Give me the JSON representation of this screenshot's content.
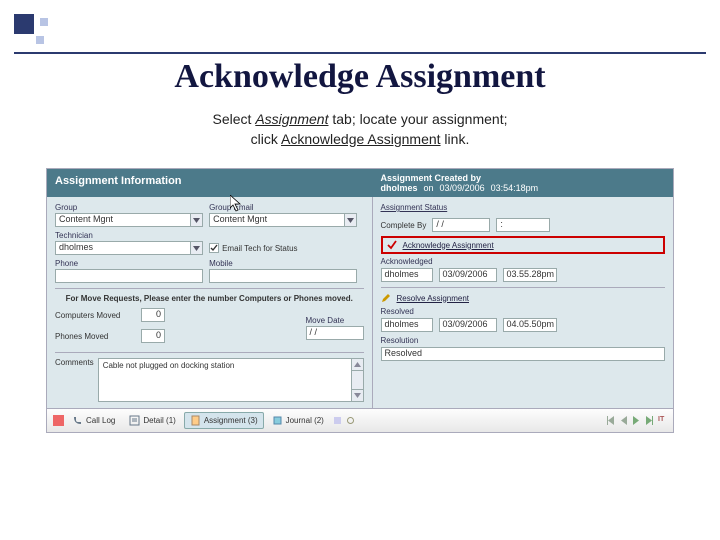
{
  "slide": {
    "title": "Acknowledge Assignment",
    "subtitle_prefix": "Select ",
    "subtitle_em": "Assignment",
    "subtitle_mid": " tab; locate your assignment;",
    "subtitle_line2_pre": "click ",
    "subtitle_link": "Acknowledge Assignment",
    "subtitle_line2_post": " link."
  },
  "header": {
    "left_title": "Assignment Information",
    "right_title": "Assignment Created by",
    "created_by": "dholmes",
    "on_label": "on",
    "created_date": "03/09/2006",
    "created_time": "03:54:18pm"
  },
  "left": {
    "group_label": "Group",
    "group_value": "Content Mgnt",
    "group_email_label": "Group Email",
    "group_email_value": "Content Mgnt",
    "technician_label": "Technician",
    "technician_value": "dholmes",
    "email_tech_label": "Email Tech for Status",
    "email_tech_checked": true,
    "phone_label": "Phone",
    "phone_value": "",
    "mobile_label": "Mobile",
    "mobile_value": "",
    "move_header": "For Move Requests, Please enter the number Computers or Phones moved.",
    "computers_label": "Computers Moved",
    "computers_value": "0",
    "phones_label": "Phones Moved",
    "phones_value": "0",
    "move_date_label": "Move Date",
    "move_date_value": "/ /",
    "comments_label": "Comments",
    "comments_value": "Cable not plugged on docking station"
  },
  "right": {
    "status_label": "Assignment Status",
    "complete_by_label": "Complete By",
    "complete_by_value": "/ /",
    "complete_by_time": ":",
    "ack_link": "Acknowledge Assignment",
    "ack_by_label": "Acknowledged",
    "ack_user": "dholmes",
    "ack_date": "03/09/2006",
    "ack_time": "03.55.28pm",
    "resolve_label": "Resolve Assignment",
    "resolved_label": "Resolved",
    "resolved_user": "dholmes",
    "resolved_date": "03/09/2006",
    "resolved_time": "04.05.50pm",
    "resolution_label": "Resolution",
    "resolution_value": "Resolved"
  },
  "tabs": {
    "call_log": "Call Log",
    "detail": "Detail (1)",
    "assignment": "Assignment (3)",
    "journal": "Journal (2)",
    "it_badge": "IT"
  }
}
